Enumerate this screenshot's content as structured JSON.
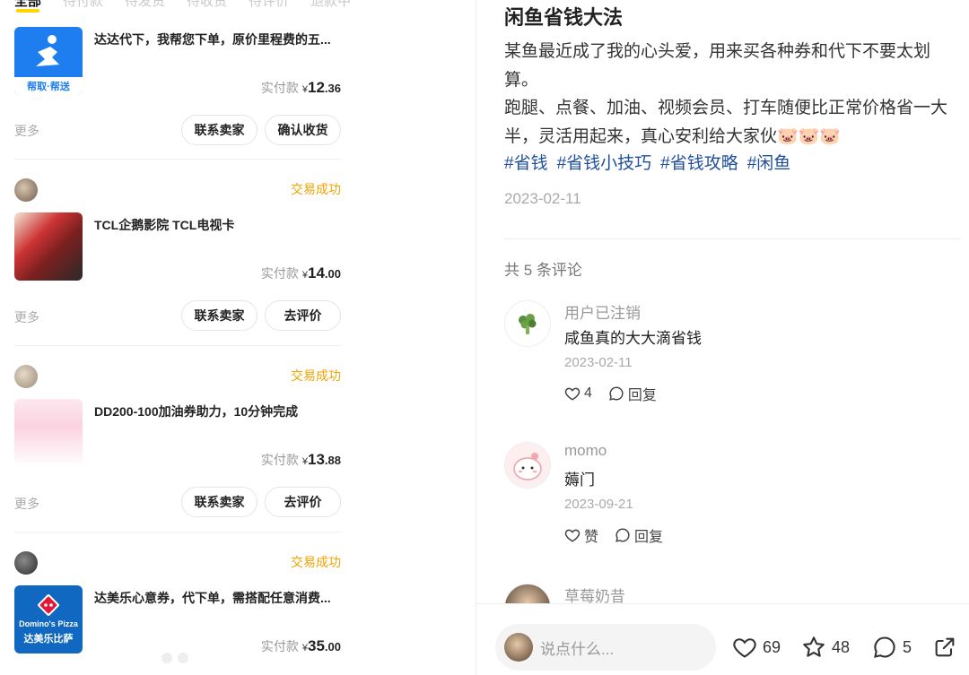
{
  "left": {
    "tabs": [
      "全部",
      "待付款",
      "待发货",
      "待收货",
      "待评价",
      "退款中"
    ],
    "orders": [
      {
        "title": "达达代下，我帮您下单，原价里程费的五...",
        "thumb_label": "帮取·帮送",
        "status": "",
        "price_label": "实付款",
        "currency": "¥",
        "price_int": "12",
        "price_dec": ".36",
        "more": "更多",
        "btn1": "联系卖家",
        "btn2": "确认收货"
      },
      {
        "seller": "",
        "title": "TCL企鹅影院 TCL电视卡",
        "status": "交易成功",
        "price_label": "实付款",
        "currency": "¥",
        "price_int": "14",
        "price_dec": ".00",
        "more": "更多",
        "btn1": "联系卖家",
        "btn2": "去评价"
      },
      {
        "seller": "",
        "title": "DD200-100加油券助力，10分钟完成",
        "status": "交易成功",
        "price_label": "实付款",
        "currency": "¥",
        "price_int": "13",
        "price_dec": ".88",
        "more": "更多",
        "btn1": "联系卖家",
        "btn2": "去评价"
      },
      {
        "seller": "",
        "title": "达美乐心意券，代下单，需搭配任意消费...",
        "thumb_en": "Domino's Pizza",
        "thumb_cn": "达美乐比萨",
        "status": "交易成功",
        "price_label": "实付款",
        "currency": "¥",
        "price_int": "35",
        "price_dec": ".00"
      }
    ]
  },
  "post": {
    "title": "闲鱼省钱大法",
    "body1": "某鱼最近成了我的心头爱，用来买各种券和代下不要太划算。",
    "body2": "跑腿、点餐、加油、视频会员、打车随便比正常价格省一大半，灵活用起来，真心安利给大家伙🐷🐷🐷",
    "tags": [
      "#省钱",
      "#省钱小技巧",
      "#省钱攻略",
      "#闲鱼"
    ],
    "date": "2023-02-11",
    "comment_count": "共 5 条评论"
  },
  "comments": [
    {
      "name": "用户已注销",
      "text": "咸鱼真的大大滴省钱",
      "date": "2023-02-11",
      "likes": "4",
      "reply": "回复"
    },
    {
      "name": "momo",
      "text": "薅门",
      "date": "2023-09-21",
      "likes": "赞",
      "reply": "回复"
    },
    {
      "name": "草莓奶昔",
      "text": "",
      "date": "",
      "likes": "",
      "reply": ""
    }
  ],
  "bottom": {
    "placeholder": "说点什么...",
    "likes": "69",
    "stars": "48",
    "comments": "5"
  },
  "colors": {
    "status": "#f4a300",
    "tag": "#1f4f9c",
    "tab_underline": "#ffd400",
    "dada_blue": "#1e7ef0",
    "dominos_blue": "#1068c1"
  }
}
